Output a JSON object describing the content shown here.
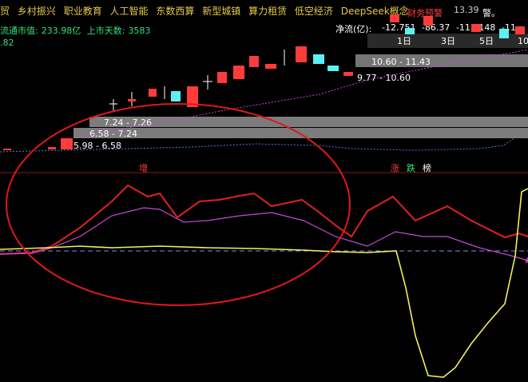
{
  "header": {
    "concept_tags": [
      "贸",
      "乡村振兴",
      "职业教育",
      "人工智能",
      "东数西算",
      "新型城镇",
      "算力租赁",
      "低空经济",
      "DeepSeek概念"
    ],
    "market_cap_label": "流通市值:",
    "market_cap_value": "233.98亿",
    "listing_days_label": "上市天数:",
    "listing_days_value": "3583",
    "left_fragment": ".82",
    "net_flow_label": "净流(亿):",
    "net_flow_values": [
      "-12.751",
      "-86.37",
      "-111.148",
      "-11"
    ],
    "period_labels": [
      "1日",
      "3日",
      "5日",
      "10"
    ],
    "finance_warning": "财务预警",
    "price_high": "13.39",
    "warning_fragment": "警。"
  },
  "price_zones": [
    {
      "label": "10.60 - 11.43"
    },
    {
      "label": "9.77 - 10.60"
    },
    {
      "label": "7.24 - 7.26"
    },
    {
      "label": "6.58 - 7.24"
    },
    {
      "label": "5.98 - 6.58"
    }
  ],
  "signals": {
    "zeng": "增",
    "zhang": "涨",
    "die": "跌",
    "bang": "榜"
  },
  "colors": {
    "up_candle": "#ff3b3b",
    "down_candle": "#5cf0f0",
    "red_line": "#e02020",
    "violet_line": "#c24bd6",
    "yellow_line": "#f0f060",
    "ellipse": "#e01818",
    "zone_bar": "#8a8a8a"
  }
}
